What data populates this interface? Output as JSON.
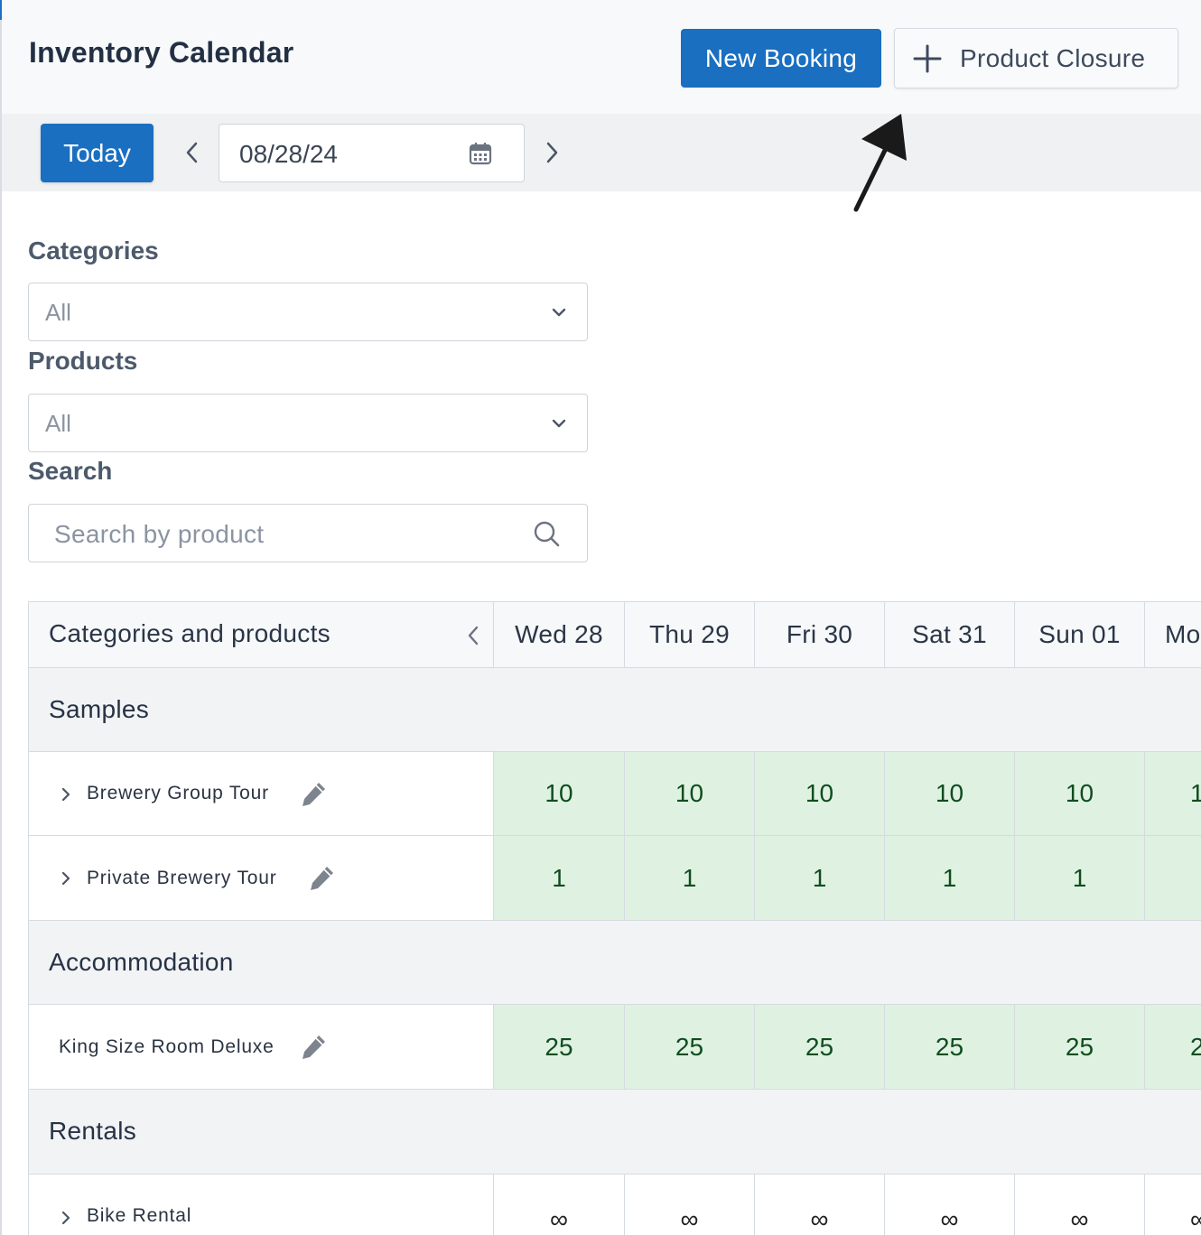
{
  "header": {
    "title": "Inventory Calendar",
    "new_booking_label": "New Booking",
    "product_closure_label": "Product Closure"
  },
  "date_nav": {
    "today_label": "Today",
    "date_value": "08/28/24"
  },
  "filters": {
    "categories_label": "Categories",
    "categories_value": "All",
    "products_label": "Products",
    "products_value": "All",
    "search_label": "Search",
    "search_placeholder": "Search by product"
  },
  "grid": {
    "first_column_title": "Categories and products",
    "days": [
      "Wed 28",
      "Thu 29",
      "Fri 30",
      "Sat 31",
      "Sun 01",
      "Mo"
    ],
    "categories": [
      {
        "name": "Samples",
        "products": [
          {
            "name": "Brewery Group Tour",
            "expandable": true,
            "values": [
              "10",
              "10",
              "10",
              "10",
              "10",
              "1"
            ]
          },
          {
            "name": "Private Brewery Tour",
            "expandable": true,
            "values": [
              "1",
              "1",
              "1",
              "1",
              "1",
              ""
            ]
          }
        ]
      },
      {
        "name": "Accommodation",
        "products": [
          {
            "name": "King Size Room Deluxe",
            "expandable": false,
            "values": [
              "25",
              "25",
              "25",
              "25",
              "25",
              "2"
            ]
          }
        ]
      },
      {
        "name": "Rentals",
        "products": [
          {
            "name": "Bike Rental",
            "expandable": true,
            "values": [
              "∞",
              "∞",
              "∞",
              "∞",
              "∞",
              "∞"
            ]
          }
        ]
      }
    ]
  },
  "colors": {
    "primary": "#1a6fc0",
    "available_bg": "#dff1e1",
    "available_text": "#0f4d1f",
    "category_bg": "#f2f3f5"
  },
  "icons": [
    "plus-icon",
    "chevron-left-icon",
    "calendar-icon",
    "chevron-right-icon",
    "chevron-down-icon",
    "search-icon",
    "expand-chevron-icon",
    "pencil-icon",
    "arrow-annotation-icon"
  ]
}
